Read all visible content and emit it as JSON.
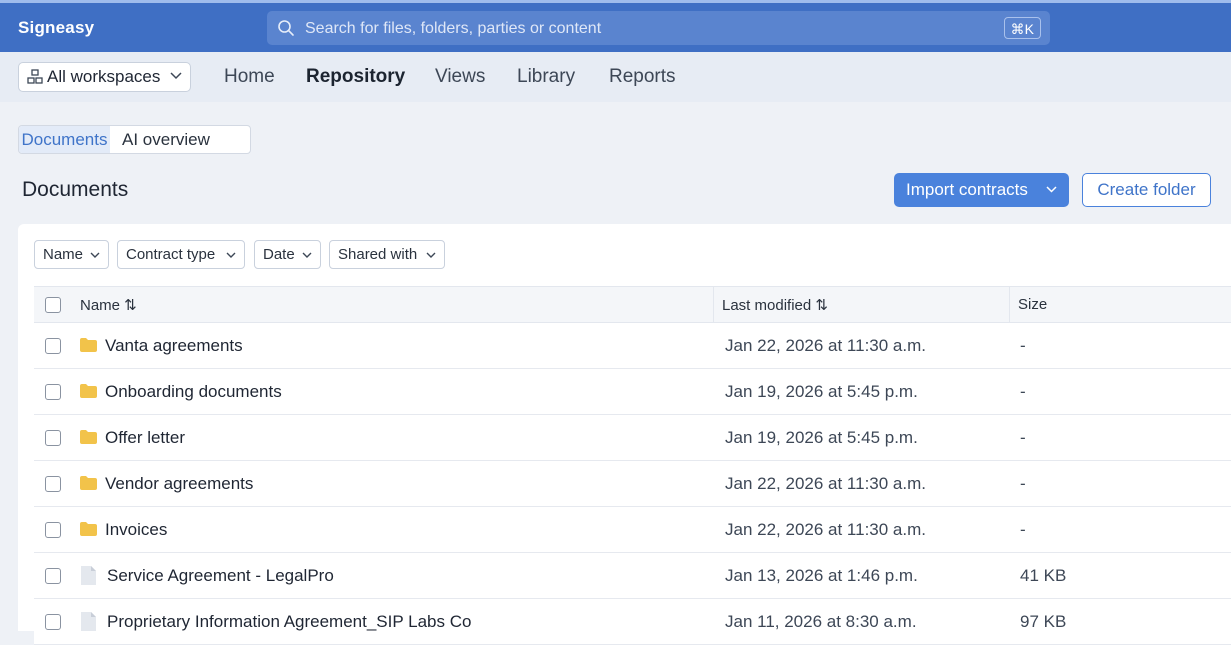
{
  "app": {
    "brand": "Signeasy"
  },
  "search": {
    "placeholder": "Search for files, folders, parties or content",
    "shortcut": "⌘K"
  },
  "workspace": {
    "label": "All workspaces"
  },
  "nav": {
    "home": "Home",
    "repository": "Repository",
    "views": "Views",
    "library": "Library",
    "reports": "Reports"
  },
  "subtabs": {
    "documents": "Documents",
    "ai_overview": "AI overview"
  },
  "page": {
    "title": "Documents",
    "import_label": "Import contracts",
    "create_folder_label": "Create folder"
  },
  "filters": {
    "name": "Name",
    "contract_type": "Contract type",
    "date": "Date",
    "shared_with": "Shared with"
  },
  "table": {
    "headers": {
      "name": "Name ⇅",
      "last_modified": "Last modified ⇅",
      "size": "Size"
    },
    "rows": [
      {
        "type": "folder",
        "name": "Vanta agreements",
        "modified": "Jan 22, 2026 at 11:30 a.m.",
        "size": "-"
      },
      {
        "type": "folder",
        "name": "Onboarding documents",
        "modified": "Jan 19, 2026 at 5:45 p.m.",
        "size": "-"
      },
      {
        "type": "folder",
        "name": "Offer letter",
        "modified": "Jan 19, 2026 at 5:45 p.m.",
        "size": "-"
      },
      {
        "type": "folder",
        "name": "Vendor agreements",
        "modified": "Jan 22, 2026 at 11:30 a.m.",
        "size": "-"
      },
      {
        "type": "folder",
        "name": "Invoices",
        "modified": "Jan 22, 2026 at 11:30 a.m.",
        "size": "-"
      },
      {
        "type": "file",
        "name": "Service Agreement - LegalPro",
        "modified": "Jan 13, 2026 at 1:46 p.m.",
        "size": "41 KB"
      },
      {
        "type": "file",
        "name": "Proprietary Information Agreement_SIP Labs Co",
        "modified": "Jan 11, 2026 at 8:30 a.m.",
        "size": "97 KB"
      }
    ]
  },
  "colors": {
    "topbar": "#3f6fc4",
    "accent": "#4a82dc",
    "folder": "#f2c34a"
  }
}
